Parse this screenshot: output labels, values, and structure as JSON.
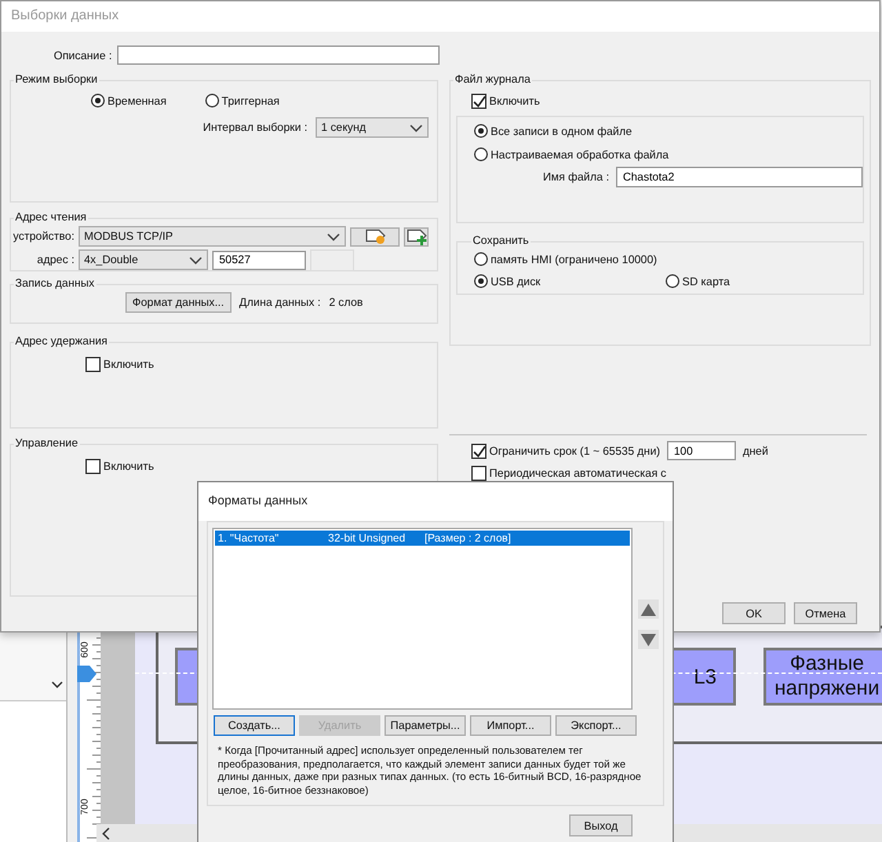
{
  "editor": {
    "ruler_labels": [
      "600",
      "700"
    ],
    "canvas_buttons": [
      {
        "lines": [
          "L3"
        ]
      },
      {
        "lines": [
          "Фазные",
          "напряжени"
        ]
      }
    ]
  },
  "main_dialog": {
    "title": "Выборки данных",
    "description": {
      "label": "Описание :"
    },
    "sampling_mode": {
      "title": "Режим выборки",
      "options": [
        {
          "label": "Временная",
          "selected": true
        },
        {
          "label": "Триггерная",
          "selected": false
        }
      ],
      "interval": {
        "label": "Интервал выборки :",
        "value": "1 секунд"
      }
    },
    "read_address": {
      "title": "Адрес чтения",
      "device_label": "устройство:",
      "device": "MODBUS TCP/IP",
      "address_label": "адрес :",
      "address_type": "4x_Double",
      "address": "50527"
    },
    "data_record": {
      "title": "Запись данных",
      "format_button": "Формат данных...",
      "length_label": "Длина данных :",
      "length": "2 слов"
    },
    "hold_address": {
      "title": "Адрес удержания",
      "enable": {
        "label": "Включить",
        "checked": false
      }
    },
    "control": {
      "title": "Управление",
      "enable": {
        "label": "Включить",
        "checked": false
      }
    },
    "log_file": {
      "title": "Файл журнала",
      "enable": {
        "label": "Включить",
        "checked": true
      },
      "file_mode": [
        {
          "label": "Все записи в одном файле",
          "selected": true
        },
        {
          "label": "Настраиваемая обработка файла",
          "selected": false
        }
      ],
      "file_name": {
        "label": "Имя файла :",
        "value": "Chastota2"
      },
      "save": {
        "title": "Сохранить",
        "options": [
          {
            "label": "память HMI (ограничено 10000)",
            "selected": false
          },
          {
            "label": "USB диск",
            "selected": true
          },
          {
            "label": "SD карта",
            "selected": false
          }
        ]
      }
    },
    "limit": {
      "label": "Ограничить срок (1 ~ 65535 дни)",
      "checked": true,
      "value": "100",
      "unit": "дней"
    },
    "periodic": {
      "label": "Периодическая автоматическая с",
      "checked": false
    },
    "buttons": [
      "OK",
      "Отмена"
    ]
  },
  "formats_dialog": {
    "title": "Форматы данных",
    "items": [
      {
        "columns": [
          "1. \"Частота\"",
          "32-bit Unsigned",
          "[Размер : 2 слов]"
        ],
        "selected": true
      }
    ],
    "buttons": [
      {
        "label": "Создать...",
        "focused": true,
        "disabled": false
      },
      {
        "label": "Удалить",
        "focused": false,
        "disabled": true
      },
      {
        "label": "Параметры...",
        "focused": false,
        "disabled": false
      },
      {
        "label": "Импорт...",
        "focused": false,
        "disabled": false
      },
      {
        "label": "Экспорт...",
        "focused": false,
        "disabled": false
      }
    ],
    "note": "* Когда [Прочитанный адрес] использует определенный пользователем тег преобразования, предполагается, что каждый элемент записи данных будет той же длины данных, даже при разных типах данных. (то есть 16-битный BCD, 16-разрядное целое, 16-битное беззнаковое)",
    "exit_button": "Выход"
  }
}
